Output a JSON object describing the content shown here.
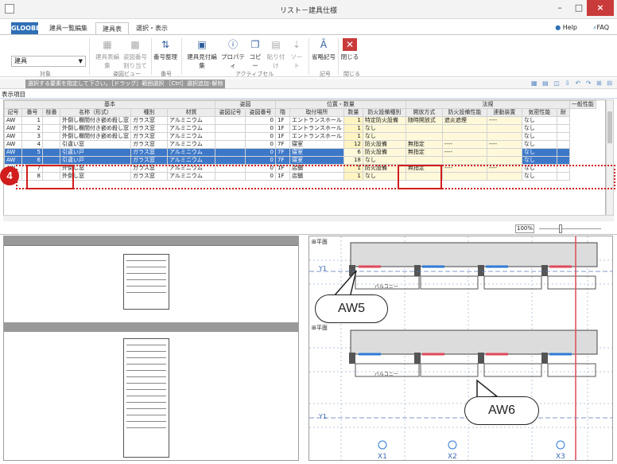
{
  "window": {
    "title": "リスト－建具仕様",
    "minimize": "–",
    "maximize": "□",
    "close": "×"
  },
  "menu": {
    "app_tab": "GLOOBE",
    "tabs": [
      "建具一覧編集",
      "建具表",
      "選択・表示"
    ],
    "active_index": 1,
    "help": "Help",
    "faq": "FAQ"
  },
  "ribbon": {
    "combo_value": "建具",
    "buttons": {
      "edit": "建具表編集",
      "window_no": "姿図番号",
      "window_no2": "割り当て",
      "sort_no": "番号整理",
      "copy_edit": "建具見付編集",
      "property": "プロパティ",
      "copy": "コピー",
      "paste": "貼り付け",
      "sort": "ソート",
      "symbol": "省略記号",
      "close": "閉じる"
    },
    "groups": [
      "対象",
      "姿図ビュー",
      "番号",
      "アクティブセル",
      "記号",
      "閉じる"
    ]
  },
  "hint": {
    "text": "選択する要素を指定して下さい。［ドラッグ］範囲選択 ［Ctrl］選択追加･解除"
  },
  "display_label": "表示項目",
  "grid": {
    "groups": [
      {
        "label": "基本",
        "span": 6
      },
      {
        "label": "姿図",
        "span": 2
      },
      {
        "label": "位置・数量",
        "span": 4
      },
      {
        "label": "法規",
        "span": 5
      },
      {
        "label": "一般性能",
        "span": 2
      }
    ],
    "headers": [
      "記号",
      "番号",
      "枝番",
      "名称（形式）",
      "種別",
      "材質",
      "姿図記号",
      "姿図番号",
      "階",
      "取付場所",
      "数量",
      "防火設備種別",
      "開放方式",
      "防火設備性能",
      "連動装置",
      "気密性能",
      "耐"
    ],
    "rows": [
      [
        "AW",
        "1",
        "",
        "外倒し欄間付き嵌め殺し窓",
        "ガラス窓",
        "アルミニウム",
        "",
        "0",
        "1F",
        "エントランスホール",
        "1",
        "特定防火設備",
        "随時開放式",
        "遮炎遮煙",
        "----",
        "なし",
        ""
      ],
      [
        "AW",
        "2",
        "",
        "外倒し欄間付き嵌め殺し窓",
        "ガラス窓",
        "アルミニウム",
        "",
        "0",
        "1F",
        "エントランスホール",
        "1",
        "なし",
        "",
        "",
        "",
        "なし",
        ""
      ],
      [
        "AW",
        "3",
        "",
        "外倒し欄間付き嵌め殺し窓",
        "ガラス窓",
        "アルミニウム",
        "",
        "0",
        "1F",
        "エントランスホール",
        "1",
        "なし",
        "",
        "",
        "",
        "なし",
        ""
      ],
      [
        "AW",
        "4",
        "",
        "引違い窓",
        "ガラス窓",
        "アルミニウム",
        "",
        "0",
        "7F",
        "寝室",
        "12",
        "防火設備",
        "無指定",
        "----",
        "----",
        "なし",
        ""
      ],
      [
        "AW",
        "5",
        "",
        "引違い戸",
        "ガラス窓",
        "アルミニウム",
        "",
        "0",
        "7F",
        "寝室",
        "6",
        "防火設備",
        "無指定",
        "----",
        "",
        "なし",
        ""
      ],
      [
        "AW",
        "6",
        "",
        "引違い戸",
        "ガラス窓",
        "アルミニウム",
        "",
        "0",
        "7F",
        "寝室",
        "18",
        "なし",
        "",
        "",
        "",
        "なし",
        ""
      ],
      [
        "AW",
        "7",
        "",
        "外倒し窓",
        "ガラス窓",
        "アルミニウム",
        "",
        "0",
        "1F",
        "店舗",
        "1",
        "防火設備",
        "無指定",
        "----",
        "----",
        "なし",
        ""
      ],
      [
        "AW",
        "8",
        "",
        "外倒し窓",
        "ガラス窓",
        "アルミニウム",
        "",
        "0",
        "1F",
        "店舗",
        "1",
        "なし",
        "",
        "",
        "",
        "なし",
        ""
      ]
    ]
  },
  "zoom": "100%",
  "plan": {
    "label": "平面",
    "balcony": "バルコニー",
    "axis_y": "Y1",
    "axis_x": [
      "X1",
      "X2",
      "X3"
    ]
  },
  "callouts": {
    "aw5": "AW5",
    "aw6": "AW6"
  },
  "step_badge": "4",
  "colors": {
    "accent": "#2f6fb6",
    "highlight": "#d11d1d",
    "selection": "#3d78c8"
  }
}
